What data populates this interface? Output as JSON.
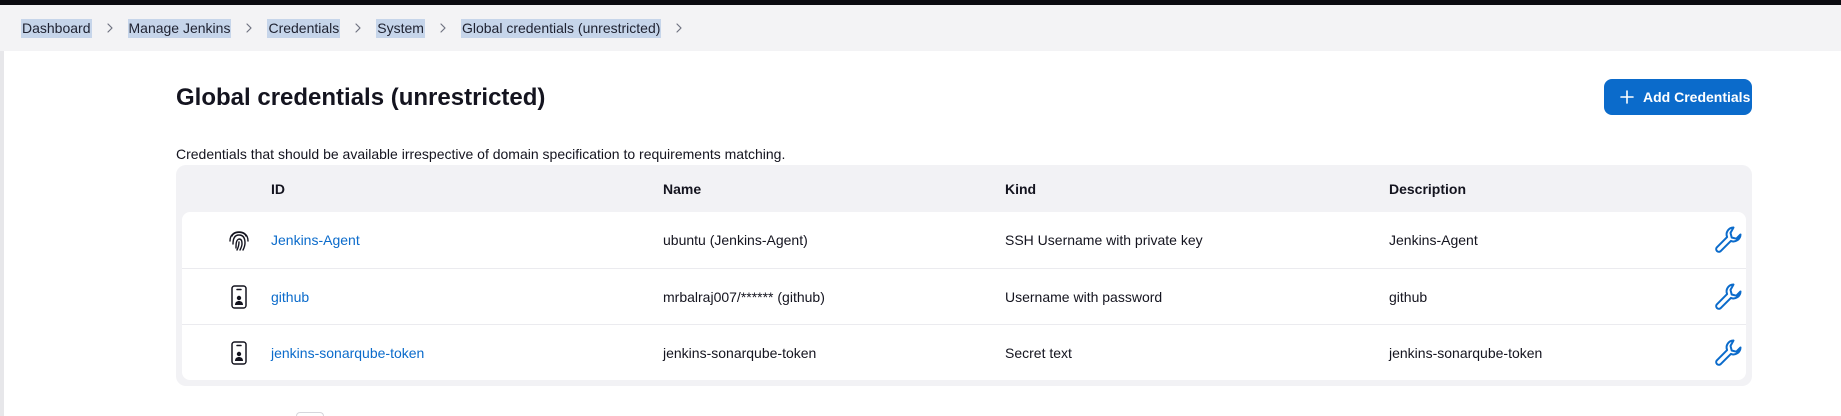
{
  "breadcrumb": {
    "items": [
      {
        "label": "Dashboard"
      },
      {
        "label": "Manage Jenkins"
      },
      {
        "label": "Credentials"
      },
      {
        "label": "System"
      },
      {
        "label": "Global credentials (unrestricted)"
      }
    ],
    "separator_icon": "chevron-right-icon"
  },
  "page": {
    "title": "Global credentials (unrestricted)",
    "description": "Credentials that should be available irrespective of domain specification to requirements matching."
  },
  "actions": {
    "add_label": "Add Credentials",
    "add_icon": "plus-icon"
  },
  "table": {
    "headers": {
      "id": "ID",
      "name": "Name",
      "kind": "Kind",
      "description": "Description"
    },
    "rows": [
      {
        "icon": "fingerprint-icon",
        "id": "Jenkins-Agent",
        "name": "ubuntu (Jenkins-Agent)",
        "kind": "SSH Username with private key",
        "description": "Jenkins-Agent",
        "action_icon": "wrench-icon"
      },
      {
        "icon": "id-badge-icon",
        "id": "github",
        "name": "mrbalraj007/****** (github)",
        "kind": "Username with password",
        "description": "github",
        "action_icon": "wrench-icon"
      },
      {
        "icon": "id-badge-icon",
        "id": "jenkins-sonarqube-token",
        "name": "jenkins-sonarqube-token",
        "kind": "Secret text",
        "description": "jenkins-sonarqube-token",
        "action_icon": "wrench-icon"
      }
    ]
  },
  "colors": {
    "accent": "#0b6bcb",
    "breadcrumb_highlight": "#c6d5ea",
    "table_background": "#f2f2f5"
  }
}
